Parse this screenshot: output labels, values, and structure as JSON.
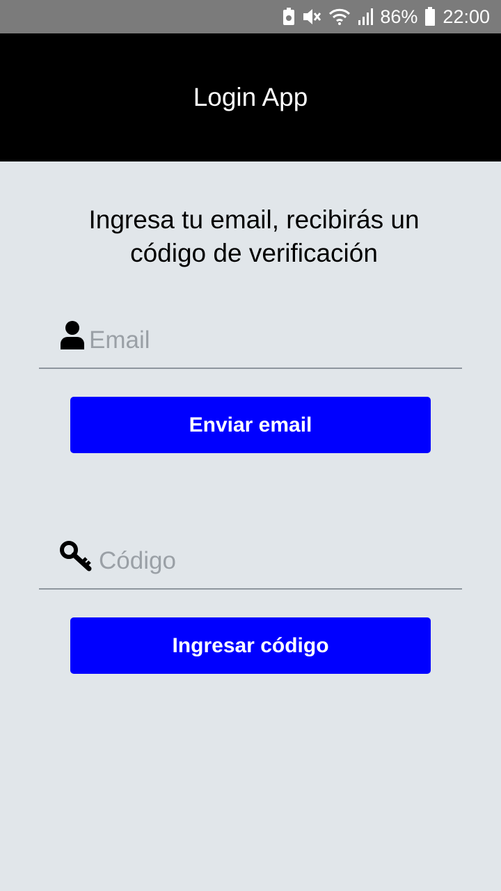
{
  "status_bar": {
    "battery_percent": "86%",
    "time": "22:00",
    "icons": [
      "battery-saver-icon",
      "mute-icon",
      "wifi-icon",
      "signal-icon",
      "battery-icon"
    ]
  },
  "app_bar": {
    "title": "Login App"
  },
  "instruction": "Ingresa tu email, recibirás un código de verificación",
  "email_field": {
    "placeholder": "Email",
    "value": "",
    "icon": "user-icon"
  },
  "send_button": {
    "label": "Enviar email"
  },
  "code_field": {
    "placeholder": "Código",
    "value": "",
    "icon": "key-icon"
  },
  "enter_button": {
    "label": "Ingresar código"
  },
  "colors": {
    "background": "#e1e6ea",
    "app_bar": "#000000",
    "button": "#0000ff",
    "status_bar": "#7b7b7b"
  }
}
